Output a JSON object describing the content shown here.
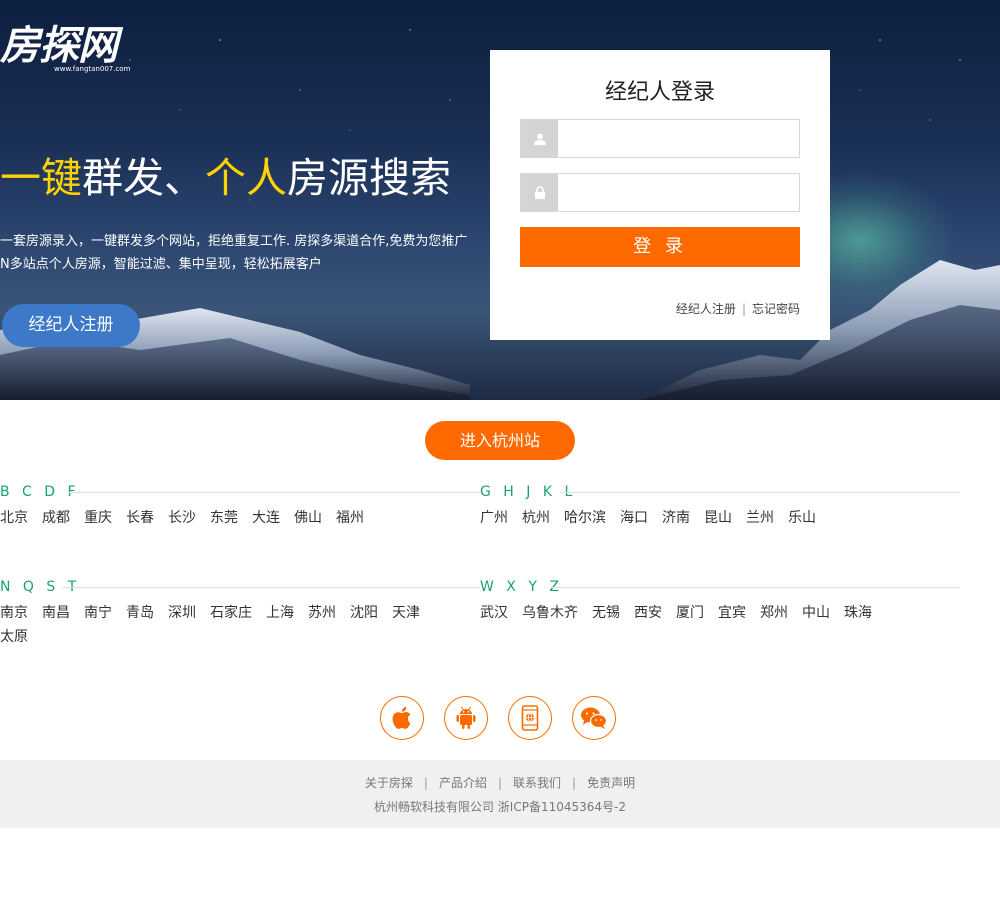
{
  "brand": {
    "logo_text": "房探网",
    "logo_url": "www.fangtan007.com"
  },
  "hero": {
    "slogan_hl1": "一键",
    "slogan_mid": "群发、",
    "slogan_hl2": "个人",
    "slogan_end": "房源搜索",
    "desc_line1": "一套房源录入，一键群发多个网站，拒绝重复工作. 房探多渠道合作,免费为您推广",
    "desc_line2": "N多站点个人房源，智能过滤、集中呈现，轻松拓展客户",
    "register_label": "经纪人注册"
  },
  "login": {
    "title": "经纪人登录",
    "username_value": "",
    "password_value": "",
    "submit_label": "登 录",
    "register_link": "经纪人注册",
    "separator": "|",
    "forgot_link": "忘记密码"
  },
  "enter_station_label": "进入杭州站",
  "city_groups": [
    {
      "letters": "B C D F",
      "cities": [
        "北京",
        "成都",
        "重庆",
        "长春",
        "长沙",
        "东莞",
        "大连",
        "佛山",
        "福州"
      ]
    },
    {
      "letters": "G H J K L",
      "cities": [
        "广州",
        "杭州",
        "哈尔滨",
        "海口",
        "济南",
        "昆山",
        "兰州",
        "乐山"
      ]
    },
    {
      "letters": "N Q S T",
      "cities": [
        "南京",
        "南昌",
        "南宁",
        "青岛",
        "深圳",
        "石家庄",
        "上海",
        "苏州",
        "沈阳",
        "天津",
        "太原"
      ]
    },
    {
      "letters": "W X Y Z",
      "cities": [
        "武汉",
        "乌鲁木齐",
        "无锡",
        "西安",
        "厦门",
        "宜宾",
        "郑州",
        "中山",
        "珠海"
      ]
    }
  ],
  "apps": [
    "apple-icon",
    "android-icon",
    "mobile-web-icon",
    "wechat-icon"
  ],
  "footer": {
    "links": [
      "关于房探",
      "产品介绍",
      "联系我们",
      "免责声明"
    ],
    "separator": "|",
    "copyright": "杭州畅软科技有限公司 浙ICP备11045364号-2"
  },
  "colors": {
    "accent": "#ff6a00",
    "letters": "#1aa36b",
    "highlight": "#ffd200",
    "register": "#3d79c8"
  }
}
